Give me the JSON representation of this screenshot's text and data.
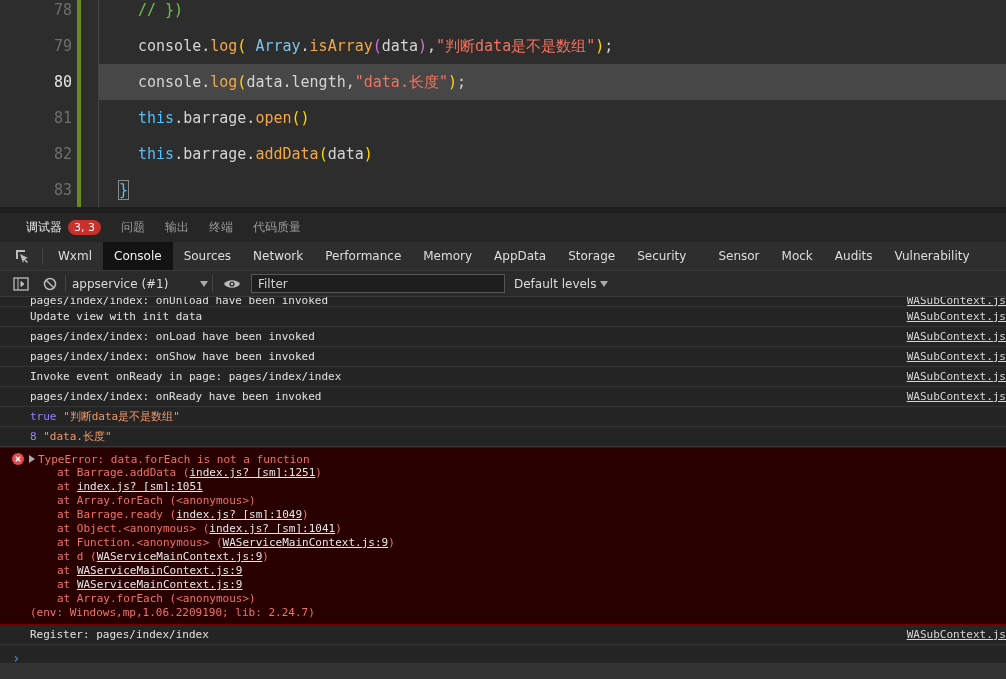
{
  "editor": {
    "lines": [
      {
        "number": "78",
        "selected": false,
        "indented": true,
        "tokens": [
          {
            "text": "// })",
            "kind": "comment"
          }
        ]
      },
      {
        "number": "79",
        "selected": false,
        "indented": true,
        "tokens": [
          {
            "text": "console.",
            "kind": "plain"
          },
          {
            "text": "log",
            "kind": "method"
          },
          {
            "text": "(",
            "kind": "bracket1"
          },
          {
            "text": " Array",
            "kind": "class"
          },
          {
            "text": ".",
            "kind": "plain"
          },
          {
            "text": "isArray",
            "kind": "method"
          },
          {
            "text": "(",
            "kind": "bracket2"
          },
          {
            "text": "data",
            "kind": "plain"
          },
          {
            "text": ")",
            "kind": "bracket2"
          },
          {
            "text": ",",
            "kind": "plain"
          },
          {
            "text": "\"判断data是不是数组\"",
            "kind": "string"
          },
          {
            "text": ")",
            "kind": "bracket1"
          },
          {
            "text": ";",
            "kind": "plain"
          }
        ]
      },
      {
        "number": "80",
        "selected": true,
        "indented": true,
        "tokens": [
          {
            "text": "console.",
            "kind": "plain"
          },
          {
            "text": "log",
            "kind": "method"
          },
          {
            "text": "(",
            "kind": "bracket1"
          },
          {
            "text": "data.length,",
            "kind": "plain"
          },
          {
            "text": "\"data.长度\"",
            "kind": "string"
          },
          {
            "text": ")",
            "kind": "bracket1"
          },
          {
            "text": ";",
            "kind": "plain"
          }
        ]
      },
      {
        "number": "81",
        "selected": false,
        "indented": true,
        "tokens": [
          {
            "text": "this",
            "kind": "keyword"
          },
          {
            "text": ".barrage.",
            "kind": "plain"
          },
          {
            "text": "open",
            "kind": "method"
          },
          {
            "text": "()",
            "kind": "bracket1"
          }
        ]
      },
      {
        "number": "82",
        "selected": false,
        "indented": true,
        "tokens": [
          {
            "text": "this",
            "kind": "keyword"
          },
          {
            "text": ".barrage.",
            "kind": "plain"
          },
          {
            "text": "addData",
            "kind": "method"
          },
          {
            "text": "(",
            "kind": "bracket1"
          },
          {
            "text": "data",
            "kind": "plain"
          },
          {
            "text": ")",
            "kind": "bracket1"
          }
        ]
      },
      {
        "number": "83",
        "selected": false,
        "indented": false,
        "tokens": [
          {
            "text": "}",
            "kind": "brace-match"
          }
        ]
      }
    ]
  },
  "panel_tabs": [
    {
      "label": "调试器",
      "selected": true,
      "badge": "3, 3"
    },
    {
      "label": "问题",
      "selected": false
    },
    {
      "label": "输出",
      "selected": false
    },
    {
      "label": "终端",
      "selected": false
    },
    {
      "label": "代码质量",
      "selected": false
    }
  ],
  "devtools_tabs": [
    {
      "label": "Wxml",
      "selected": false
    },
    {
      "label": "Console",
      "selected": true
    },
    {
      "label": "Sources",
      "selected": false
    },
    {
      "label": "Network",
      "selected": false
    },
    {
      "label": "Performance",
      "selected": false
    },
    {
      "label": "Memory",
      "selected": false
    },
    {
      "label": "AppData",
      "selected": false
    },
    {
      "label": "Storage",
      "selected": false
    },
    {
      "label": "Security",
      "selected": false
    },
    {
      "label": "Sensor",
      "selected": false
    },
    {
      "label": "Mock",
      "selected": false
    },
    {
      "label": "Audits",
      "selected": false
    },
    {
      "label": "Vulnerability",
      "selected": false
    }
  ],
  "toolbar": {
    "context": "appservice (#1)",
    "filter": {
      "placeholder": "Filter"
    },
    "levels": "Default levels"
  },
  "console": [
    {
      "kind": "log",
      "cut": true,
      "message": "pages/index/index: onUnload have been invoked",
      "source": "WASubContext.js"
    },
    {
      "kind": "log",
      "message": "Update view with init data",
      "source": "WASubContext.js"
    },
    {
      "kind": "log",
      "message": "pages/index/index: onLoad have been invoked",
      "source": "WASubContext.js"
    },
    {
      "kind": "log",
      "message": "pages/index/index: onShow have been invoked",
      "source": "WASubContext.js"
    },
    {
      "kind": "log",
      "message": "Invoke event onReady in page: pages/index/index",
      "source": "WASubContext.js"
    },
    {
      "kind": "log",
      "message": "pages/index/index: onReady have been invoked",
      "source": "WASubContext.js"
    },
    {
      "kind": "value",
      "values": [
        {
          "text": "true",
          "kind": "boolean"
        },
        {
          "text": "\"判断data是不是数组\"",
          "kind": "string"
        }
      ]
    },
    {
      "kind": "value",
      "values": [
        {
          "text": "8",
          "kind": "number"
        },
        {
          "text": "\"data.长度\"",
          "kind": "string"
        }
      ]
    },
    {
      "kind": "error",
      "expanded": false,
      "message": "TypeError: data.forEach is not a function",
      "stack": [
        [
          {
            "text": "at Barrage.addData ("
          },
          {
            "text": "index.js? [sm]:1251",
            "link": true
          },
          {
            "text": ")"
          }
        ],
        [
          {
            "text": "at "
          },
          {
            "text": "index.js? [sm]:1051",
            "link": true
          }
        ],
        [
          {
            "text": "at Array.forEach (<anonymous>)"
          }
        ],
        [
          {
            "text": "at Barrage.ready ("
          },
          {
            "text": "index.js? [sm]:1049",
            "link": true
          },
          {
            "text": ")"
          }
        ],
        [
          {
            "text": "at Object.<anonymous> ("
          },
          {
            "text": "index.js? [sm]:1041",
            "link": true
          },
          {
            "text": ")"
          }
        ],
        [
          {
            "text": "at Function.<anonymous> ("
          },
          {
            "text": "WAServiceMainContext.js:9",
            "link": true
          },
          {
            "text": ")"
          }
        ],
        [
          {
            "text": "at d ("
          },
          {
            "text": "WAServiceMainContext.js:9",
            "link": true
          },
          {
            "text": ")"
          }
        ],
        [
          {
            "text": "at "
          },
          {
            "text": "WAServiceMainContext.js:9",
            "link": true
          }
        ],
        [
          {
            "text": "at "
          },
          {
            "text": "WAServiceMainContext.js:9",
            "link": true
          }
        ],
        [
          {
            "text": "at Array.forEach (<anonymous>)"
          }
        ]
      ],
      "env": "(env: Windows,mp,1.06.2209190; lib: 2.24.7)"
    },
    {
      "kind": "log",
      "message": "Register: pages/index/index",
      "source": "WASubContext.js"
    },
    {
      "kind": "prompt",
      "symbol": "›"
    }
  ]
}
